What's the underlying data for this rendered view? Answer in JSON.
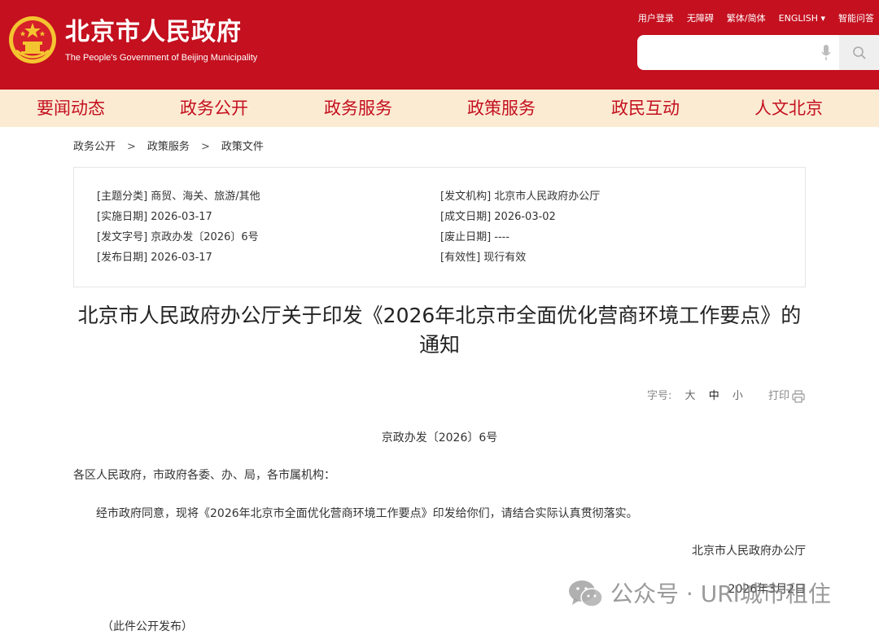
{
  "header": {
    "title": "北京市人民政府",
    "subtitle": "The People's Government of Beijing Municipality",
    "links": [
      "用户登录",
      "无障碍",
      "繁体/简体",
      "ENGLISH ▾",
      "智能问答"
    ],
    "search_placeholder": ""
  },
  "nav": {
    "items": [
      "要闻动态",
      "政务公开",
      "政务服务",
      "政策服务",
      "政民互动",
      "人文北京"
    ]
  },
  "breadcrumb": [
    "政务公开",
    "政策服务",
    "政策文件"
  ],
  "breadcrumb_sep": ">",
  "meta": {
    "topic": "[主题分类] 商贸、海关、旅游/其他",
    "issuer": "[发文机构] 北京市人民政府办公厅",
    "effective_date": "[实施日期] 2026-03-17",
    "written_date": "[成文日期] 2026-03-02",
    "doc_number": "[发文字号] 京政办发〔2026〕6号",
    "repeal_date": "[废止日期] ----",
    "publish_date": "[发布日期] 2026-03-17",
    "validity": "[有效性] 现行有效"
  },
  "document": {
    "title": "北京市人民政府办公厅关于印发《2026年北京市全面优化营商环境工作要点》的通知",
    "doc_no": "京政办发〔2026〕6号",
    "salutation": "各区人民政府，市政府各委、办、局，各市属机构：",
    "paragraph": "经市政府同意，现将《2026年北京市全面优化营商环境工作要点》印发给你们，请结合实际认真贯彻落实。",
    "sign_org": "北京市人民政府办公厅",
    "sign_date": "2026年3月2日",
    "note": "（此件公开发布）"
  },
  "tools": {
    "font_label": "字号:",
    "large": "大",
    "medium": "中",
    "small": "小",
    "print": "打印"
  },
  "watermark": {
    "text": "公众号 · URI城市租住"
  },
  "colors": {
    "header_red": "#c4101f",
    "nav_bg": "#fbebd3",
    "nav_text": "#c4101f"
  }
}
